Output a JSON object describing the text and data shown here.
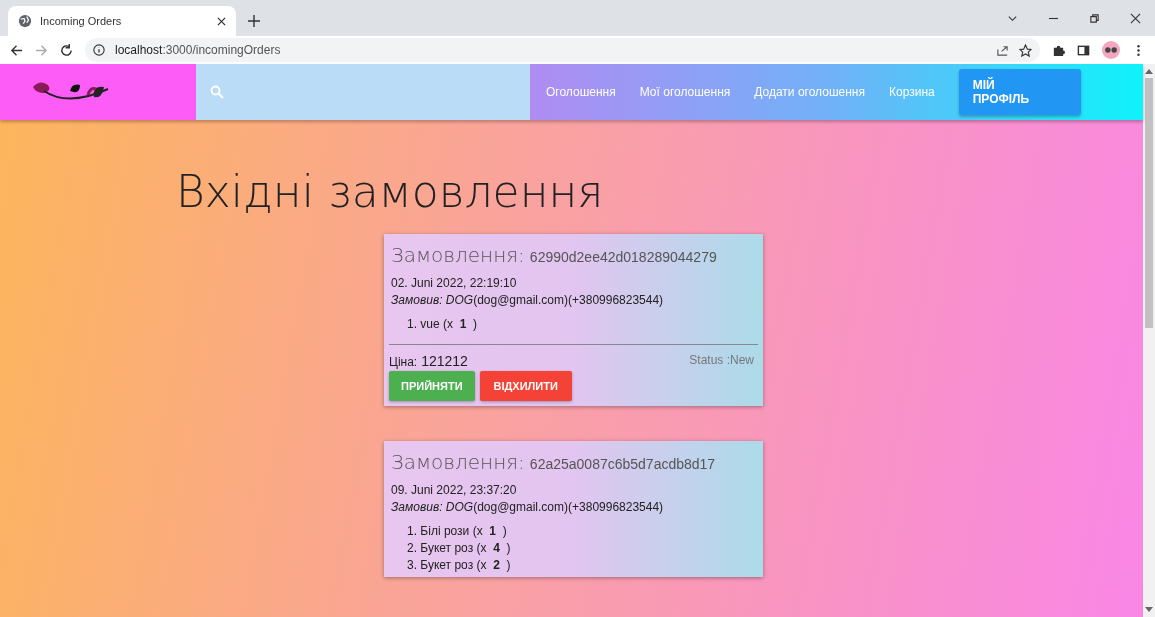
{
  "browser": {
    "tab_title": "Incoming Orders",
    "url_host": "localhost",
    "url_path": ":3000/incomingOrders"
  },
  "navbar": {
    "links": [
      {
        "label": "Оголошення"
      },
      {
        "label": "Мої оголошення"
      },
      {
        "label": "Додати оголошення"
      },
      {
        "label": "Корзина"
      }
    ],
    "profile_button": "МІЙ ПРОФІЛЬ"
  },
  "page_title": "Вхідні замовлення",
  "orders": [
    {
      "heading": "Замовлення:",
      "id": "62990d2ee42d018289044279",
      "date": "02. Juni 2022, 22:19:10",
      "customer": "*Замовив: DOG*(dog@gmail.com)(+380996823544)",
      "items": [
        "1. vue (x  **1**  )"
      ],
      "price_label": "Ціна:",
      "price": "121212",
      "status": "Status :New",
      "actions": [
        {
          "label": "ПРИЙНЯТИ",
          "kind": "accept"
        },
        {
          "label": "ВІДХИЛИТИ",
          "kind": "reject"
        }
      ]
    },
    {
      "heading": "Замовлення:",
      "id": "62a25a0087c6b5d7acdb8d17",
      "date": "09. Juni 2022, 23:37:20",
      "customer": "*Замовив: DOG*(dog@gmail.com)(+380996823544)",
      "items": [
        "1. Білі рози (x  **1**  )",
        "2. Букет роз (x  **4**  )",
        "3. Букет роз (x  **2**  )"
      ]
    }
  ]
}
